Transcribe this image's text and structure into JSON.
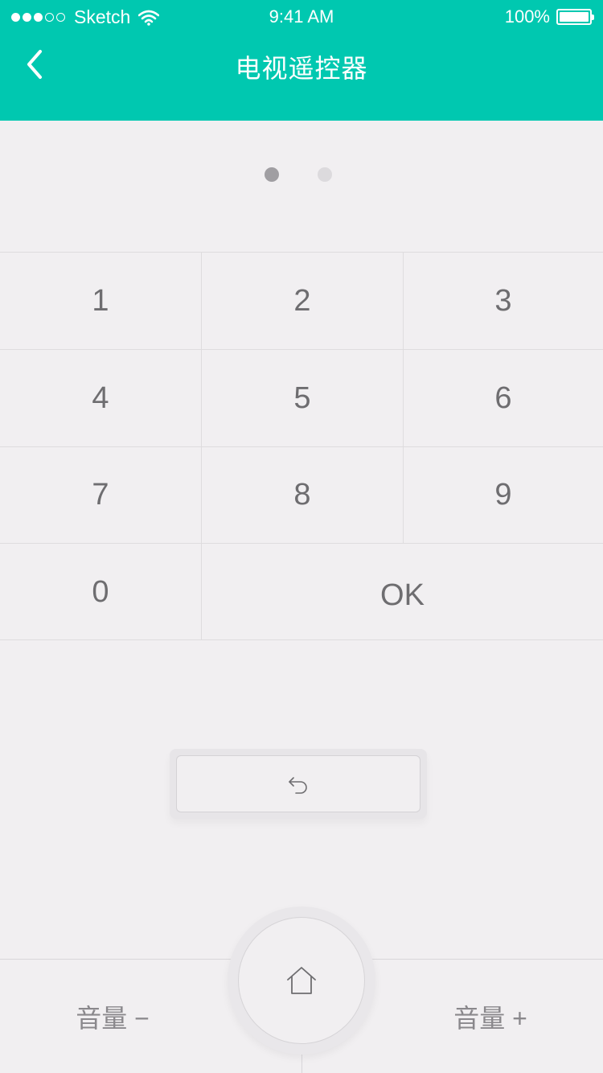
{
  "status_bar": {
    "carrier": "Sketch",
    "time": "9:41 AM",
    "battery": "100%",
    "signal_full": 3,
    "signal_total": 5
  },
  "nav": {
    "title": "电视遥控器",
    "back_icon": "chevron-left-icon"
  },
  "pager": {
    "pages": 2,
    "active": 0
  },
  "keypad": {
    "keys": [
      "1",
      "2",
      "3",
      "4",
      "5",
      "6",
      "7",
      "8",
      "9",
      "0",
      "OK"
    ]
  },
  "controls": {
    "back_icon": "undo-arrow-icon",
    "home_icon": "home-icon",
    "volume_down": "音量 −",
    "volume_up": "音量 +"
  },
  "colors": {
    "accent": "#00c8b0",
    "background": "#f1eff1",
    "text": "#6e6d70"
  }
}
